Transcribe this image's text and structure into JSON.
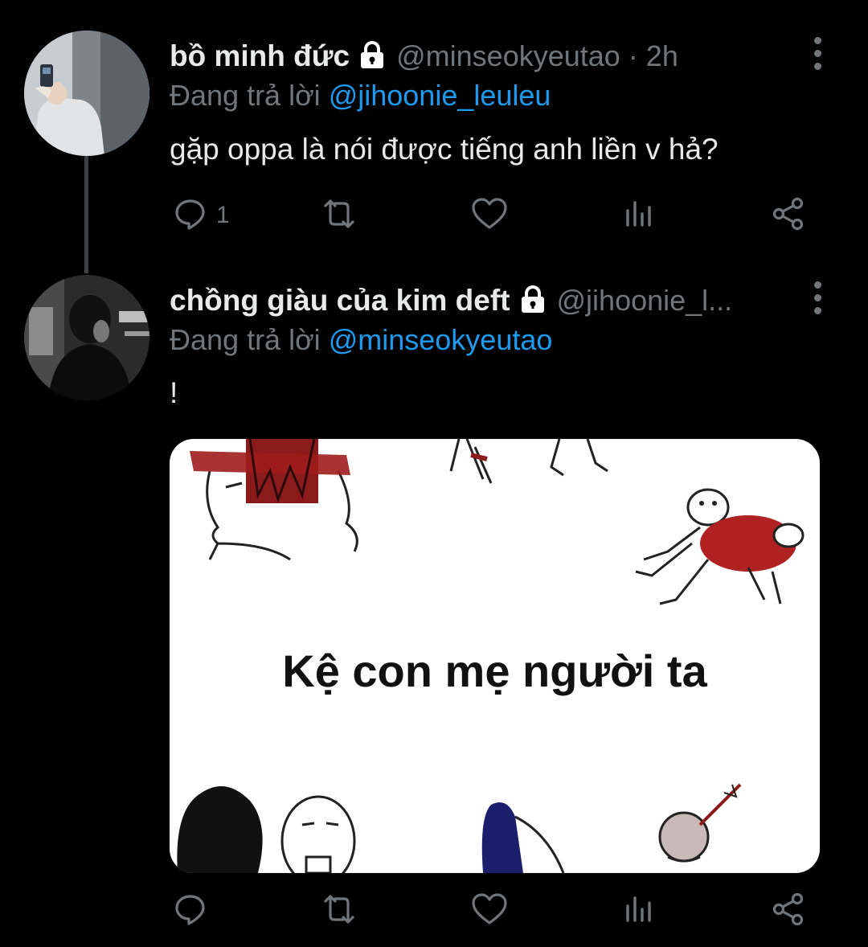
{
  "tweets": [
    {
      "display_name": "bồ minh đức",
      "handle_time": "@minseokyeutao · 2h",
      "reply_prefix": "Đang trả lời",
      "reply_to": "@jihoonie_leuleu",
      "text": "gặp oppa là nói được tiếng anh liền v hả?",
      "reply_count": "1",
      "icons": [
        "lock-icon",
        "more-icon",
        "reply-icon",
        "retweet-icon",
        "like-icon",
        "analytics-icon",
        "share-icon"
      ]
    },
    {
      "display_name": "chồng giàu của kim deft",
      "handle_time": "@jihoonie_l...",
      "reply_prefix": "Đang trả lời",
      "reply_to": "@minseokyeutao",
      "text": "!",
      "reply_count": "",
      "media_caption": "Kệ con mẹ người ta",
      "icons": [
        "lock-icon",
        "more-icon",
        "reply-icon",
        "retweet-icon",
        "like-icon",
        "analytics-icon",
        "share-icon"
      ]
    }
  ],
  "colors": {
    "background": "#000000",
    "text": "#e7e9ea",
    "secondary": "#71767b",
    "mention": "#1d9bf0",
    "thread_line": "#3e4144"
  }
}
